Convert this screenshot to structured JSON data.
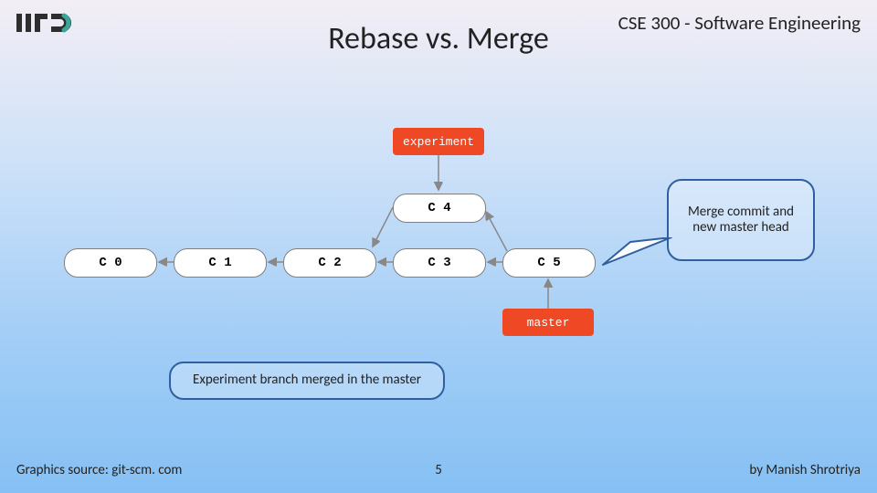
{
  "header": {
    "course": "CSE 300 - Software Engineering",
    "title": "Rebase vs. Merge"
  },
  "commits": {
    "c0": "C 0",
    "c1": "C 1",
    "c2": "C 2",
    "c3": "C 3",
    "c4": "C 4",
    "c5": "C 5"
  },
  "tags": {
    "experiment": "experiment",
    "master": "master"
  },
  "callouts": {
    "merge_head": "Merge commit and new master head",
    "experiment_merged": "Experiment branch merged in the master"
  },
  "footer": {
    "source": "Graphics source: git-scm. com",
    "page": "5",
    "author": "by Manish Shrotriya"
  }
}
